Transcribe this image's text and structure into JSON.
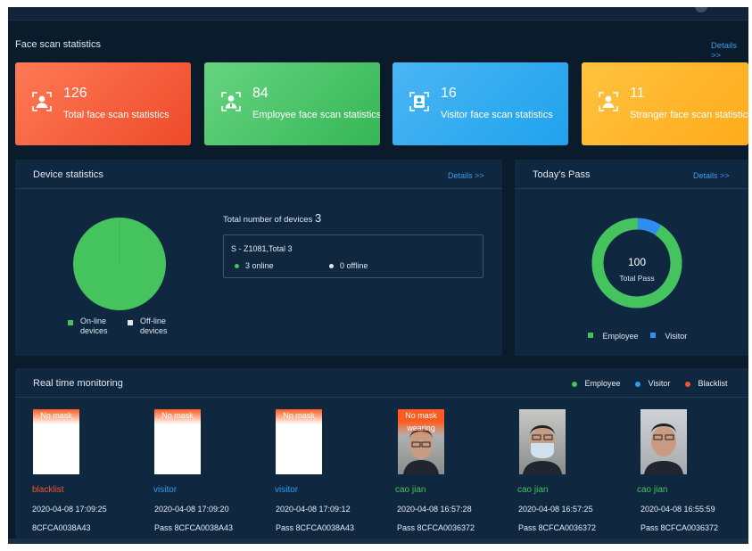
{
  "face_scan": {
    "title": "Face scan statistics",
    "details": "Details >>",
    "cards": [
      {
        "count": "126",
        "label": "Total face scan statistics",
        "color_from": "#ff6f4f",
        "color_to": "#ef4a2c"
      },
      {
        "count": "84",
        "label": "Employee face scan statistics",
        "color_from": "#5fd17a",
        "color_to": "#39b85a"
      },
      {
        "count": "16",
        "label": "Visitor face scan statistics",
        "color_from": "#41b2f2",
        "color_to": "#22a4ee"
      },
      {
        "count": "11",
        "label": "Stranger face scan statistics",
        "color_from": "#ffbd3a",
        "color_to": "#ffaf22"
      }
    ]
  },
  "device": {
    "title": "Device statistics",
    "details": "Details >>",
    "total_label": "Total number of devices",
    "total_value": "3",
    "box_title": "S - Z1081,Total 3",
    "online": "3 online",
    "offline": "0 offline",
    "legend_online": "On-line devices",
    "legend_offline": "Off-line devices",
    "online_color": "#45c35d",
    "offline_color": "#e6e6e6"
  },
  "today": {
    "title": "Today's Pass",
    "details": "Details >>",
    "total_num": "100",
    "total_label": "Total Pass",
    "legend_employee": "Employee",
    "legend_visitor": "Visitor",
    "employee_fraction": 0.91,
    "employee_color": "#45c35d",
    "visitor_color": "#2f8ef0"
  },
  "realtime": {
    "title": "Real time monitoring",
    "legend": {
      "employee": "Employee",
      "visitor": "Visitor",
      "blacklist": "Blacklist"
    },
    "legend_colors": {
      "employee": "#45c35d",
      "visitor": "#2f9bf0",
      "blacklist": "#f2542d"
    },
    "records": [
      {
        "badge": "No mask",
        "who": "blacklist",
        "time": "2020-04-08 17:09:25",
        "pass": "8CFCA0038A43",
        "color": "#f2542d"
      },
      {
        "badge": "No mask",
        "who": "visitor",
        "time": "2020-04-08 17:09:20",
        "pass": "Pass 8CFCA0038A43",
        "color": "#2f9bf0"
      },
      {
        "badge": "No mask",
        "who": "visitor",
        "time": "2020-04-08 17:09:12",
        "pass": "Pass 8CFCA0038A43",
        "color": "#2f9bf0"
      },
      {
        "badge": "No mask wearing",
        "who": "cao jian",
        "time": "2020-04-08 16:57:28",
        "pass": "Pass 8CFCA0036372",
        "color": "#45c35d"
      },
      {
        "badge": "",
        "who": "cao jian",
        "time": "2020-04-08 16:57:25",
        "pass": "Pass 8CFCA0036372",
        "color": "#45c35d"
      },
      {
        "badge": "",
        "who": "cao jian",
        "time": "2020-04-08 16:55:59",
        "pass": "Pass 8CFCA0036372",
        "color": "#45c35d"
      }
    ]
  }
}
